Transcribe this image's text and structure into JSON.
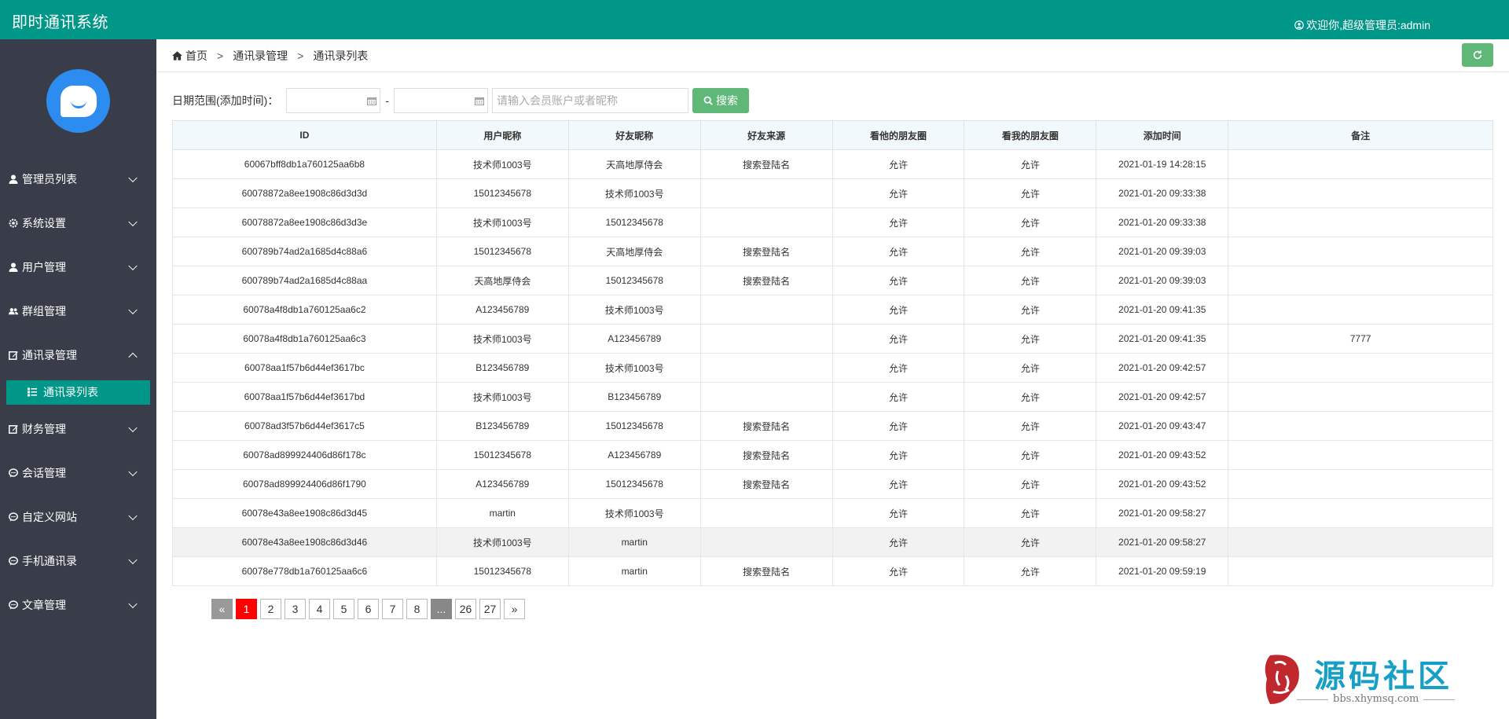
{
  "header": {
    "title": "即时通讯系统",
    "welcome": "欢迎你,超级管理员:admin"
  },
  "sidebar": {
    "items": [
      {
        "label": "管理员列表",
        "icon": "user-icon"
      },
      {
        "label": "系统设置",
        "icon": "gear-icon"
      },
      {
        "label": "用户管理",
        "icon": "user-icon"
      },
      {
        "label": "群组管理",
        "icon": "users-icon"
      },
      {
        "label": "通讯录管理",
        "icon": "edit-icon",
        "expanded": true
      },
      {
        "label": "财务管理",
        "icon": "edit-icon"
      },
      {
        "label": "会话管理",
        "icon": "comment-icon"
      },
      {
        "label": "自定义网站",
        "icon": "comment-icon"
      },
      {
        "label": "手机通讯录",
        "icon": "comment-icon"
      },
      {
        "label": "文章管理",
        "icon": "comment-icon"
      }
    ],
    "active_sub": "通讯录列表"
  },
  "breadcrumb": {
    "home": "首页",
    "level1": "通讯录管理",
    "level2": "通讯录列表",
    "separator": ">"
  },
  "filter": {
    "label": "日期范围(添加时间)：",
    "dash": "-",
    "search_placeholder": "请输入会员账户或者昵称",
    "search_button": "搜索"
  },
  "table": {
    "columns": [
      "ID",
      "用户昵称",
      "好友昵称",
      "好友来源",
      "看他的朋友圈",
      "看我的朋友圈",
      "添加时间",
      "备注"
    ],
    "rows": [
      [
        "60067bff8db1a760125aa6b8",
        "技术师1003号",
        "天高地厚侍会",
        "搜索登陆名",
        "允许",
        "允许",
        "2021-01-19 14:28:15",
        ""
      ],
      [
        "60078872a8ee1908c86d3d3d",
        "15012345678",
        "技术师1003号",
        "",
        "允许",
        "允许",
        "2021-01-20 09:33:38",
        ""
      ],
      [
        "60078872a8ee1908c86d3d3e",
        "技术师1003号",
        "15012345678",
        "",
        "允许",
        "允许",
        "2021-01-20 09:33:38",
        ""
      ],
      [
        "600789b74ad2a1685d4c88a6",
        "15012345678",
        "天高地厚侍会",
        "搜索登陆名",
        "允许",
        "允许",
        "2021-01-20 09:39:03",
        ""
      ],
      [
        "600789b74ad2a1685d4c88aa",
        "天高地厚侍会",
        "15012345678",
        "搜索登陆名",
        "允许",
        "允许",
        "2021-01-20 09:39:03",
        ""
      ],
      [
        "60078a4f8db1a760125aa6c2",
        "A123456789",
        "技术师1003号",
        "",
        "允许",
        "允许",
        "2021-01-20 09:41:35",
        ""
      ],
      [
        "60078a4f8db1a760125aa6c3",
        "技术师1003号",
        "A123456789",
        "",
        "允许",
        "允许",
        "2021-01-20 09:41:35",
        "7777"
      ],
      [
        "60078aa1f57b6d44ef3617bc",
        "B123456789",
        "技术师1003号",
        "",
        "允许",
        "允许",
        "2021-01-20 09:42:57",
        ""
      ],
      [
        "60078aa1f57b6d44ef3617bd",
        "技术师1003号",
        "B123456789",
        "",
        "允许",
        "允许",
        "2021-01-20 09:42:57",
        ""
      ],
      [
        "60078ad3f57b6d44ef3617c5",
        "B123456789",
        "15012345678",
        "搜索登陆名",
        "允许",
        "允许",
        "2021-01-20 09:43:47",
        ""
      ],
      [
        "60078ad899924406d86f178c",
        "15012345678",
        "A123456789",
        "搜索登陆名",
        "允许",
        "允许",
        "2021-01-20 09:43:52",
        ""
      ],
      [
        "60078ad899924406d86f1790",
        "A123456789",
        "15012345678",
        "搜索登陆名",
        "允许",
        "允许",
        "2021-01-20 09:43:52",
        ""
      ],
      [
        "60078e43a8ee1908c86d3d45",
        "martin",
        "技术师1003号",
        "",
        "允许",
        "允许",
        "2021-01-20 09:58:27",
        ""
      ],
      [
        "60078e43a8ee1908c86d3d46",
        "技术师1003号",
        "martin",
        "",
        "允许",
        "允许",
        "2021-01-20 09:58:27",
        ""
      ],
      [
        "60078e778db1a760125aa6c6",
        "15012345678",
        "martin",
        "搜索登陆名",
        "允许",
        "允许",
        "2021-01-20 09:59:19",
        ""
      ]
    ],
    "highlighted_row": 13
  },
  "pagination": {
    "prev": "«",
    "pages": [
      "1",
      "2",
      "3",
      "4",
      "5",
      "6",
      "7",
      "8",
      "...",
      "26",
      "27"
    ],
    "current": "1",
    "next": "»"
  },
  "watermark": {
    "seal": "小猿",
    "text": "源码社区",
    "url": "bbs.xhymsq.com"
  },
  "colors": {
    "primary": "#009688",
    "sidebar_bg": "#393d49",
    "button_green": "#5fb878",
    "pager_active": "#ff0000"
  }
}
